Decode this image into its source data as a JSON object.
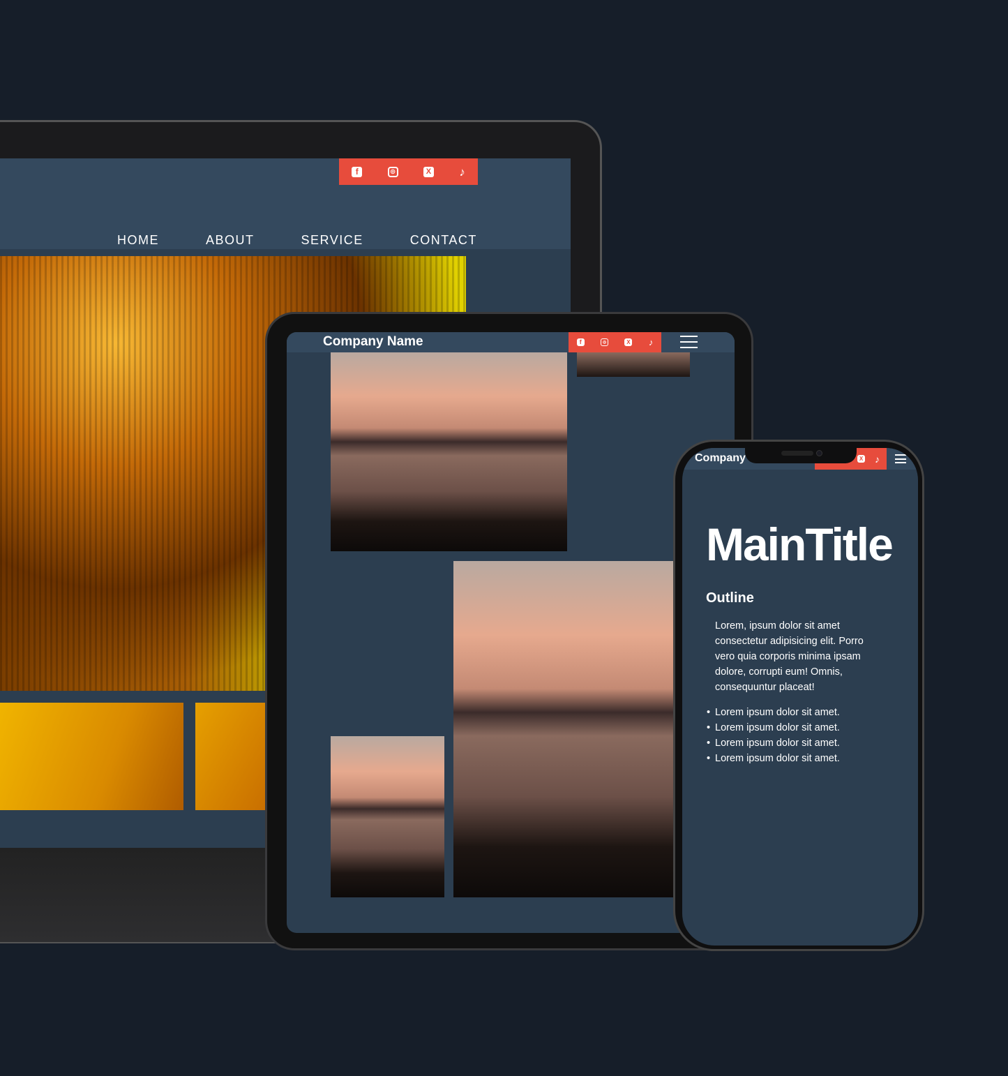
{
  "colors": {
    "background": "#161e29",
    "header": "#34495e",
    "content": "#2c3e50",
    "accent": "#e74c3c"
  },
  "social_icons": [
    "facebook-icon",
    "instagram-icon",
    "x-icon",
    "tiktok-icon"
  ],
  "laptop": {
    "nav": [
      "HOME",
      "ABOUT",
      "SERVICE",
      "CONTACT"
    ]
  },
  "tablet": {
    "company_name": "Company Name"
  },
  "phone": {
    "company_name": "Company",
    "main_title": "MainTitle",
    "outline": "Outline",
    "paragraph": "Lorem, ipsum dolor sit amet consectetur adipisicing elit. Porro vero quia corporis minima ipsam dolore, corrupti eum! Omnis, consequuntur placeat!",
    "bullets": [
      "Lorem ipsum dolor sit amet.",
      "Lorem ipsum dolor sit amet.",
      "Lorem ipsum dolor sit amet.",
      "Lorem ipsum dolor sit amet."
    ]
  }
}
